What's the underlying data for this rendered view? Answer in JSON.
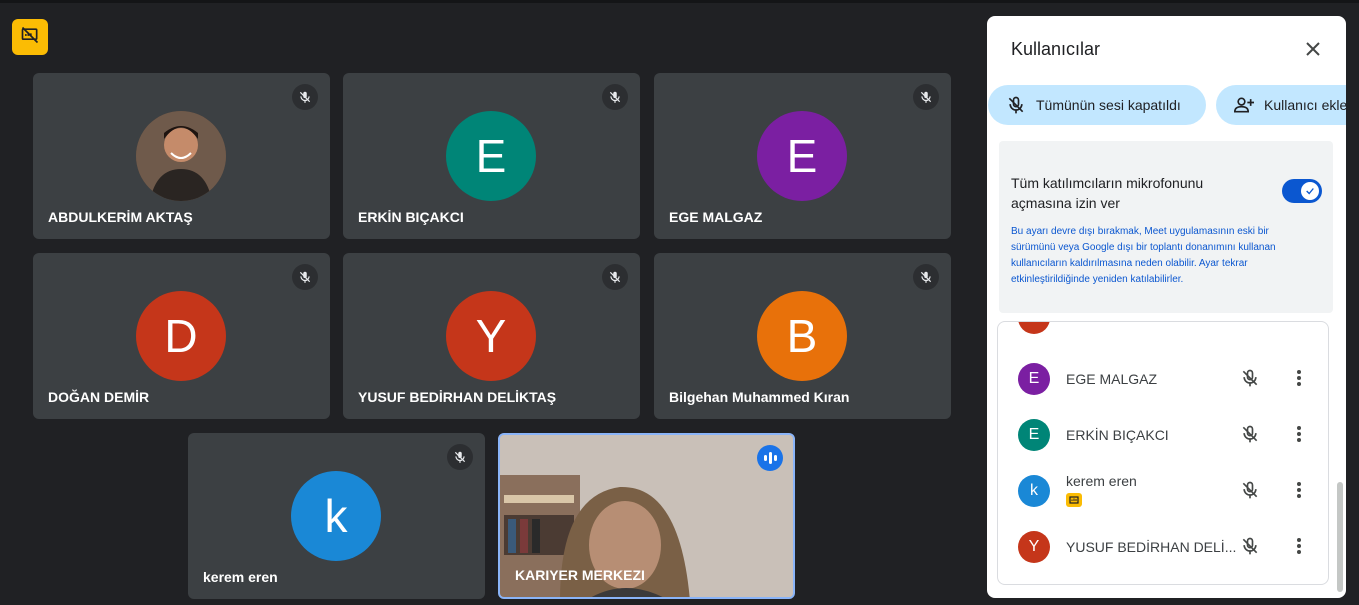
{
  "colors": {
    "tile_bg": "#3c4043",
    "accent_blue": "#1a73e8",
    "badge_yellow": "#fbbc04"
  },
  "tiles": [
    {
      "name": "ABDULKERİM AKTAŞ",
      "initial": "",
      "color": "#5b4336",
      "photo": true
    },
    {
      "name": "ERKİN BIÇAKCI",
      "initial": "E",
      "color": "#008577"
    },
    {
      "name": "EGE MALGAZ",
      "initial": "E",
      "color": "#7b1fa2"
    },
    {
      "name": "DOĞAN DEMİR",
      "initial": "D",
      "color": "#c5361a"
    },
    {
      "name": "YUSUF BEDİRHAN DELİKTAŞ",
      "initial": "Y",
      "color": "#c5361a"
    },
    {
      "name": "Bilgehan Muhammed Kıran",
      "initial": "B",
      "color": "#e8710a"
    },
    {
      "name": "kerem eren",
      "initial": "k",
      "color": "#1a88d6"
    },
    {
      "name": "KARIYER MERKEZI",
      "initial": "",
      "video": true
    }
  ],
  "panel": {
    "title": "Kullanıcılar",
    "mute_all_label": "Tümünün sesi kapatıldı",
    "add_user_label": "Kullanıcı ekle",
    "setting_label": "Tüm katılımcıların mikrofonunu açmasına izin ver",
    "setting_note": "Bu ayarı devre dışı bırakmak, Meet uygulamasının eski bir sürümünü veya Google dışı bir toplantı donanımını kullanan kullanıcıların kaldırılmasına neden olabilir. Ayar tekrar etkinleştirildiğinde yeniden katılabilirler.",
    "toggle_on": true,
    "participants": [
      {
        "name": "EGE MALGAZ",
        "initial": "E",
        "color": "#7b1fa2"
      },
      {
        "name": "ERKİN BIÇAKCI",
        "initial": "E",
        "color": "#008577"
      },
      {
        "name": "kerem eren",
        "initial": "k",
        "color": "#1a88d6",
        "presenting": true
      },
      {
        "name": "YUSUF BEDİRHAN DELİ...",
        "initial": "Y",
        "color": "#c5361a"
      }
    ]
  }
}
